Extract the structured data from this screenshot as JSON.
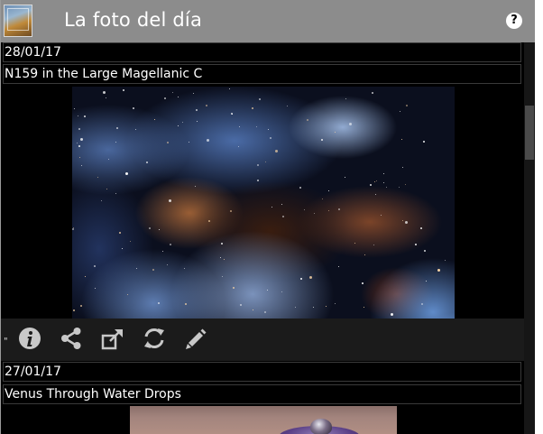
{
  "header": {
    "title": "La foto del día",
    "help_label": "?"
  },
  "feed": [
    {
      "date": "28/01/17",
      "name": "N159 in the Large Magellanic C"
    },
    {
      "date": "27/01/17",
      "name": "Venus Through Water Drops"
    }
  ],
  "toolbar": {
    "leading_mark": "\"",
    "icons": [
      "info-icon",
      "share-icon",
      "open-external-icon",
      "refresh-icon",
      "edit-icon"
    ]
  },
  "colors": {
    "header_bg": "#8c8c8c",
    "app_bg": "#000000",
    "toolbar_bg": "#1b1b1b",
    "icon_color": "#c8c8c8"
  }
}
